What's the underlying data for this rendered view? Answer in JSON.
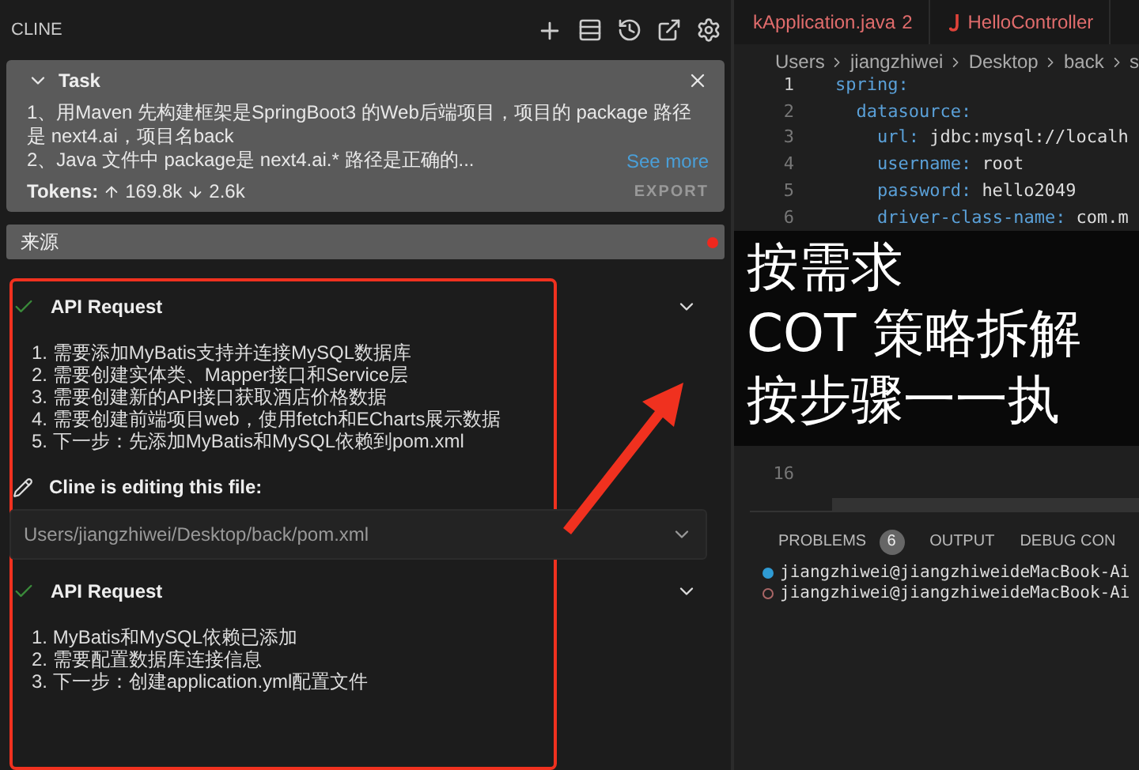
{
  "sidebar": {
    "title": "CLINE",
    "task": {
      "title": "Task",
      "expanded": true,
      "paragraphs": [
        "1、用Maven 先构建框架是SpringBoot3 的Web后端项目，项目的 package 路径是 next4.ai，项目名back",
        "2、Java 文件中 package是 next4.ai.* 路径是正确的..."
      ],
      "see_more": "See more",
      "tokens_label": "Tokens:",
      "tokens_up": "169.8k",
      "tokens_down": "2.6k",
      "export": "EXPORT"
    },
    "source_field": {
      "value": "来源"
    },
    "messages": [
      {
        "kind": "api_request",
        "title": "API Request",
        "expanded": false,
        "items": [
          "1. 需要添加MyBatis支持并连接MySQL数据库",
          "2. 需要创建实体类、Mapper接口和Service层",
          "3. 需要创建新的API接口获取酒店价格数据",
          "4. 需要创建前端项目web，使用fetch和ECharts展示数据",
          "5. 下一步：先添加MyBatis和MySQL依赖到pom.xml"
        ]
      },
      {
        "kind": "file_edit",
        "title": "Cline is editing this file:",
        "path": "Users/jiangzhiwei/Desktop/back/pom.xml"
      },
      {
        "kind": "api_request",
        "title": "API Request",
        "expanded": false,
        "items": [
          "1. MyBatis和MySQL依赖已添加",
          "2. 需要配置数据库连接信息",
          "3. 下一步：创建application.yml配置文件"
        ]
      }
    ]
  },
  "editor": {
    "tabs": [
      {
        "label": "kApplication.java",
        "badge": "2"
      },
      {
        "label": "HelloController"
      }
    ],
    "breadcrumbs": [
      "Users",
      "jiangzhiwei",
      "Desktop",
      "back",
      "s"
    ],
    "lines": [
      {
        "number": "1",
        "key": "spring:",
        "children": [
          {
            "number": "2",
            "key": "datasource:",
            "children": [
              {
                "number": "3",
                "key": "url:",
                "value": "jdbc:mysql://localh"
              },
              {
                "number": "4",
                "key": "username:",
                "value": "root"
              },
              {
                "number": "5",
                "key": "password:",
                "value": "hello2049"
              },
              {
                "number": "6",
                "key": "driver-class-name:",
                "value": "com.m"
              }
            ]
          }
        ]
      }
    ],
    "after_lines": [
      {
        "number": "16"
      }
    ],
    "annotation": {
      "lines": [
        "按需求",
        "COT 策略拆解",
        "按步骤一一执"
      ]
    }
  },
  "panel": {
    "tabs": [
      {
        "label": "PROBLEMS",
        "badge": "6"
      },
      {
        "label": "OUTPUT"
      },
      {
        "label": "DEBUG CON"
      }
    ],
    "terminal_lines": [
      {
        "text": "jiangzhiwei@jiangzhiweideMacBook-Ai",
        "active": true
      },
      {
        "text": "jiangzhiwei@jiangzhiweideMacBook-Ai",
        "active": false
      }
    ]
  }
}
